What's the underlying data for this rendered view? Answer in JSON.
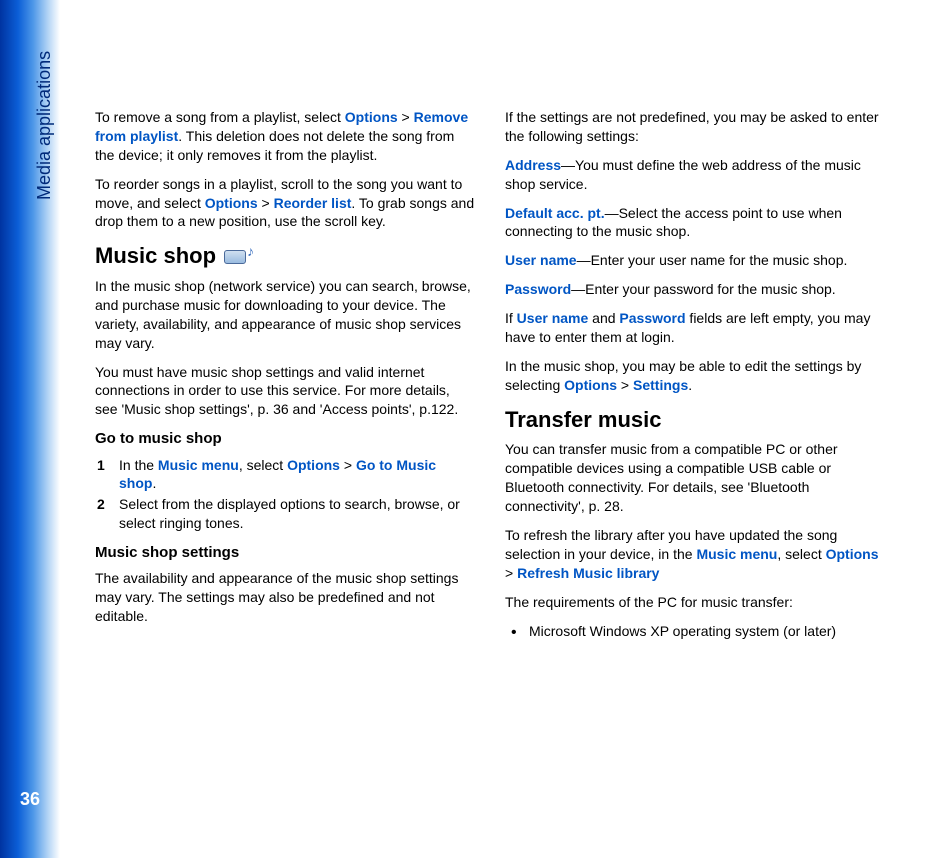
{
  "sidebar": {
    "section_label": "Media applications",
    "page_number": "36"
  },
  "left": {
    "p1": {
      "t1": "To remove a song from a playlist, select ",
      "options": "Options",
      "sep1": " > ",
      "remove": "Remove from playlist",
      "t2": ". This deletion does not delete the song from the device; it only removes it from the playlist."
    },
    "p2": {
      "t1": "To reorder songs in a playlist, scroll to the song you want to move, and select ",
      "options": "Options",
      "sep1": " > ",
      "reorder": "Reorder list",
      "t2": ". To grab songs and drop them to a new position, use the scroll key."
    },
    "h_music_shop": "Music shop",
    "p3": "In the music shop (network service) you can search, browse, and purchase music for downloading to your device. The variety, availability, and appearance of music shop services may vary.",
    "p4": "You must have music shop settings and valid internet connections in order to use this service. For more details, see 'Music shop settings', p. 36 and 'Access points', p.122.",
    "h_go_to": "Go to music shop",
    "step1": {
      "t1": "In the ",
      "music_menu": "Music menu",
      "t2": ", select ",
      "options": "Options",
      "sep1": " > ",
      "goto": "Go to Music shop",
      "t3": "."
    },
    "step2": "Select from the displayed options to search, browse, or select ringing tones.",
    "h_settings": "Music shop settings",
    "p5": "The availability and appearance of the music shop settings may vary. The settings may also be predefined and not editable."
  },
  "right": {
    "p1": "If the settings are not predefined, you may be asked to enter the following settings:",
    "address": {
      "label": "Address",
      "text": "—You must define the web address of the music shop service."
    },
    "default_ap": {
      "label": "Default acc. pt.",
      "text": "—Select the access point to use when connecting to the music shop."
    },
    "username": {
      "label": "User name",
      "text": "—Enter your user name for the music shop."
    },
    "password": {
      "label": "Password",
      "text": "—Enter your password for the music shop."
    },
    "p_empty": {
      "t1": "If ",
      "u": "User name",
      "t2": " and ",
      "p": "Password",
      "t3": " fields are left empty, you may have to enter them at login."
    },
    "p_edit": {
      "t1": "In the music shop, you may be able to edit the settings by selecting ",
      "options": "Options",
      "sep": " > ",
      "settings": "Settings",
      "t2": "."
    },
    "h_transfer": "Transfer music",
    "p_tr1": "You can transfer music from a compatible PC or other compatible devices using a compatible USB cable or Bluetooth connectivity. For details, see 'Bluetooth connectivity', p. 28.",
    "p_tr2": {
      "t1": "To refresh the library after you have updated the song selection in your device, in the ",
      "music_menu": "Music menu",
      "t2": ", select ",
      "options": "Options",
      "sep": " > ",
      "refresh": "Refresh Music library"
    },
    "p_req": "The requirements of the PC for music transfer:",
    "bullet1": "Microsoft Windows XP operating system (or later)"
  }
}
